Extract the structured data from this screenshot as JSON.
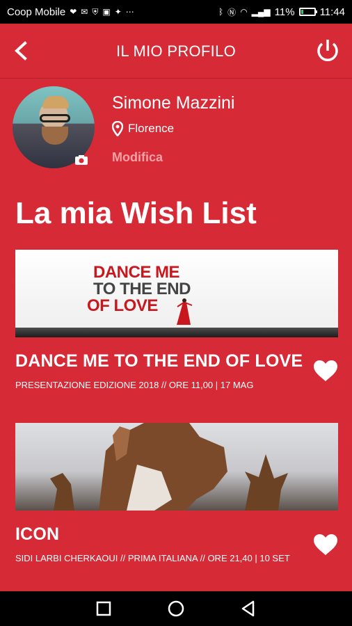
{
  "status_bar": {
    "carrier": "Coop Mobile",
    "battery": "11%",
    "time": "11:44"
  },
  "app_bar": {
    "title": "IL MIO PROFILO",
    "back_icon": "back-chevron-icon",
    "power_icon": "power-icon"
  },
  "profile": {
    "name": "Simone Mazzini",
    "location": "Florence",
    "edit_label": "Modifica"
  },
  "wishlist": {
    "heading": "La mia Wish List",
    "items": [
      {
        "title": "DANCE ME TO THE END OF LOVE",
        "subtitle": "PRESENTAZIONE EDIZIONE 2018 // ORE 11,00 | 17 MAG",
        "image_text": [
          "DANCE ME",
          "TO THE END",
          "OF LOVE"
        ],
        "favorite": true
      },
      {
        "title": "ICON",
        "subtitle": "SIDI LARBI CHERKAOUI // PRIMA ITALIANA // ORE 21,40   | 10 SET",
        "favorite": true
      }
    ]
  },
  "colors": {
    "primary_red": "#d62b37",
    "edit_pink": "#f3a1a7"
  }
}
